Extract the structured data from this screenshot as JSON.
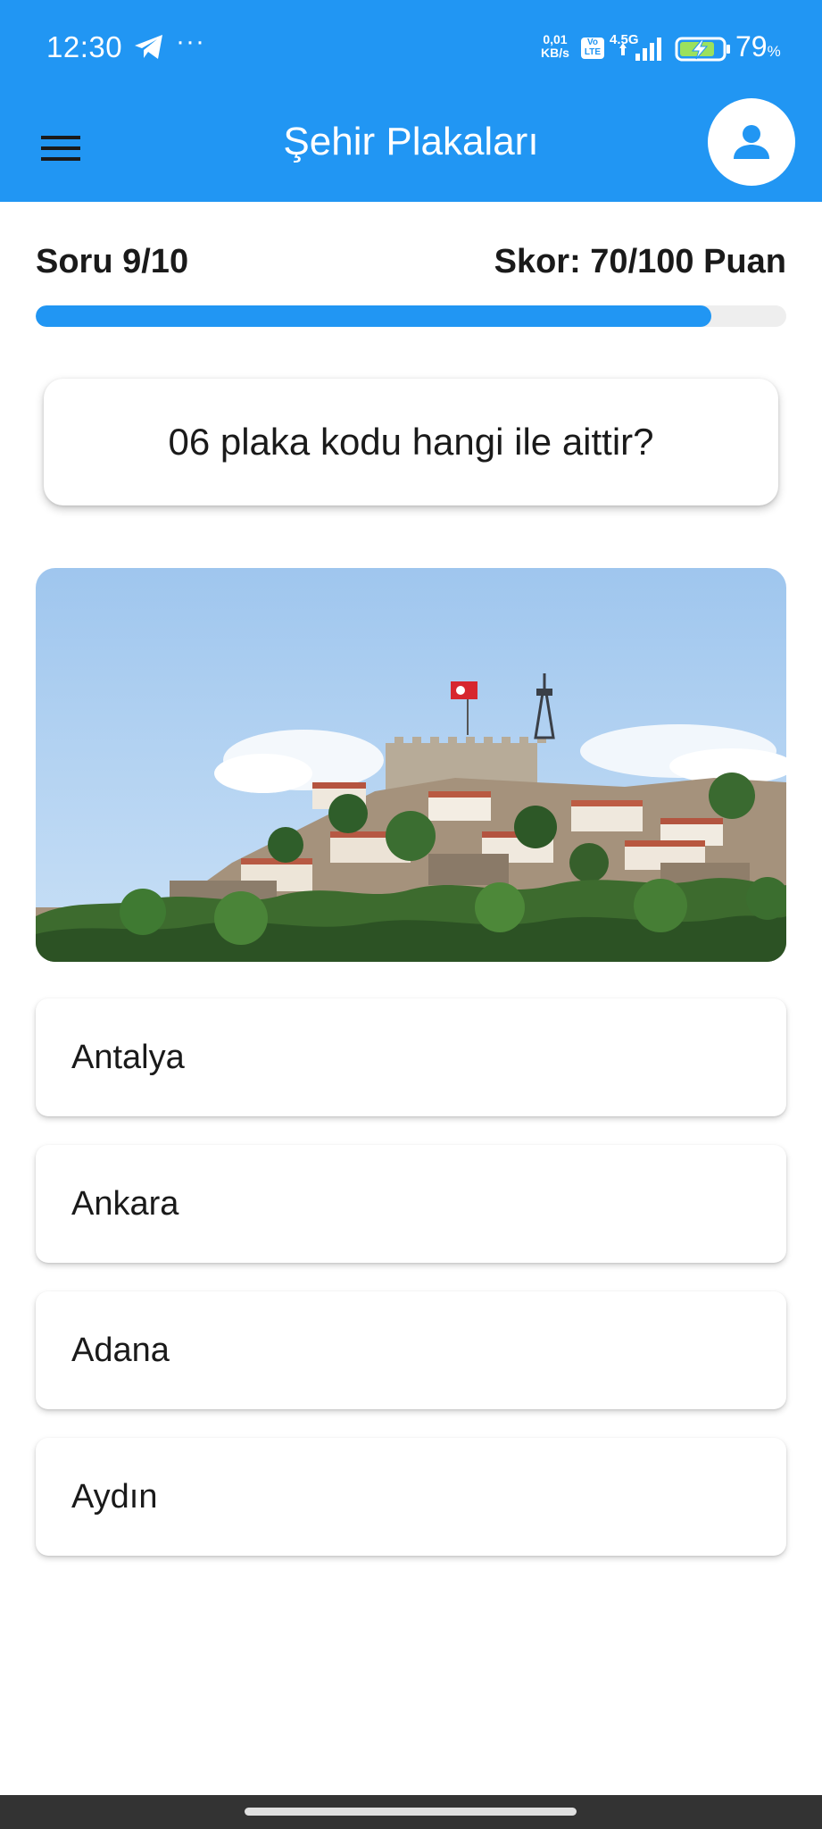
{
  "status_bar": {
    "time": "12:30",
    "dots": "···",
    "net_speed_value": "0,01",
    "net_speed_unit": "KB/s",
    "volte_line1": "Vo",
    "volte_line2": "LTE",
    "network_type": "4.5G",
    "battery_percent": "79",
    "battery_unit": "%",
    "icons": [
      "telegram-icon",
      "signal-icon",
      "battery-charging-icon"
    ]
  },
  "app_bar": {
    "title": "Şehir Plakaları",
    "menu_icon": "menu-icon",
    "profile_icon": "person-icon"
  },
  "quiz": {
    "question_counter": "Soru 9/10",
    "score": "Skor: 70/100 Puan",
    "progress": 0.9,
    "question": "06 plaka kodu hangi ile aittir?",
    "options": [
      {
        "label": "Antalya"
      },
      {
        "label": "Ankara"
      },
      {
        "label": "Adana"
      },
      {
        "label": "Aydın"
      }
    ]
  },
  "colors": {
    "primary": "#2196F3",
    "track": "#eeeeee",
    "nav_bar": "#333333"
  }
}
